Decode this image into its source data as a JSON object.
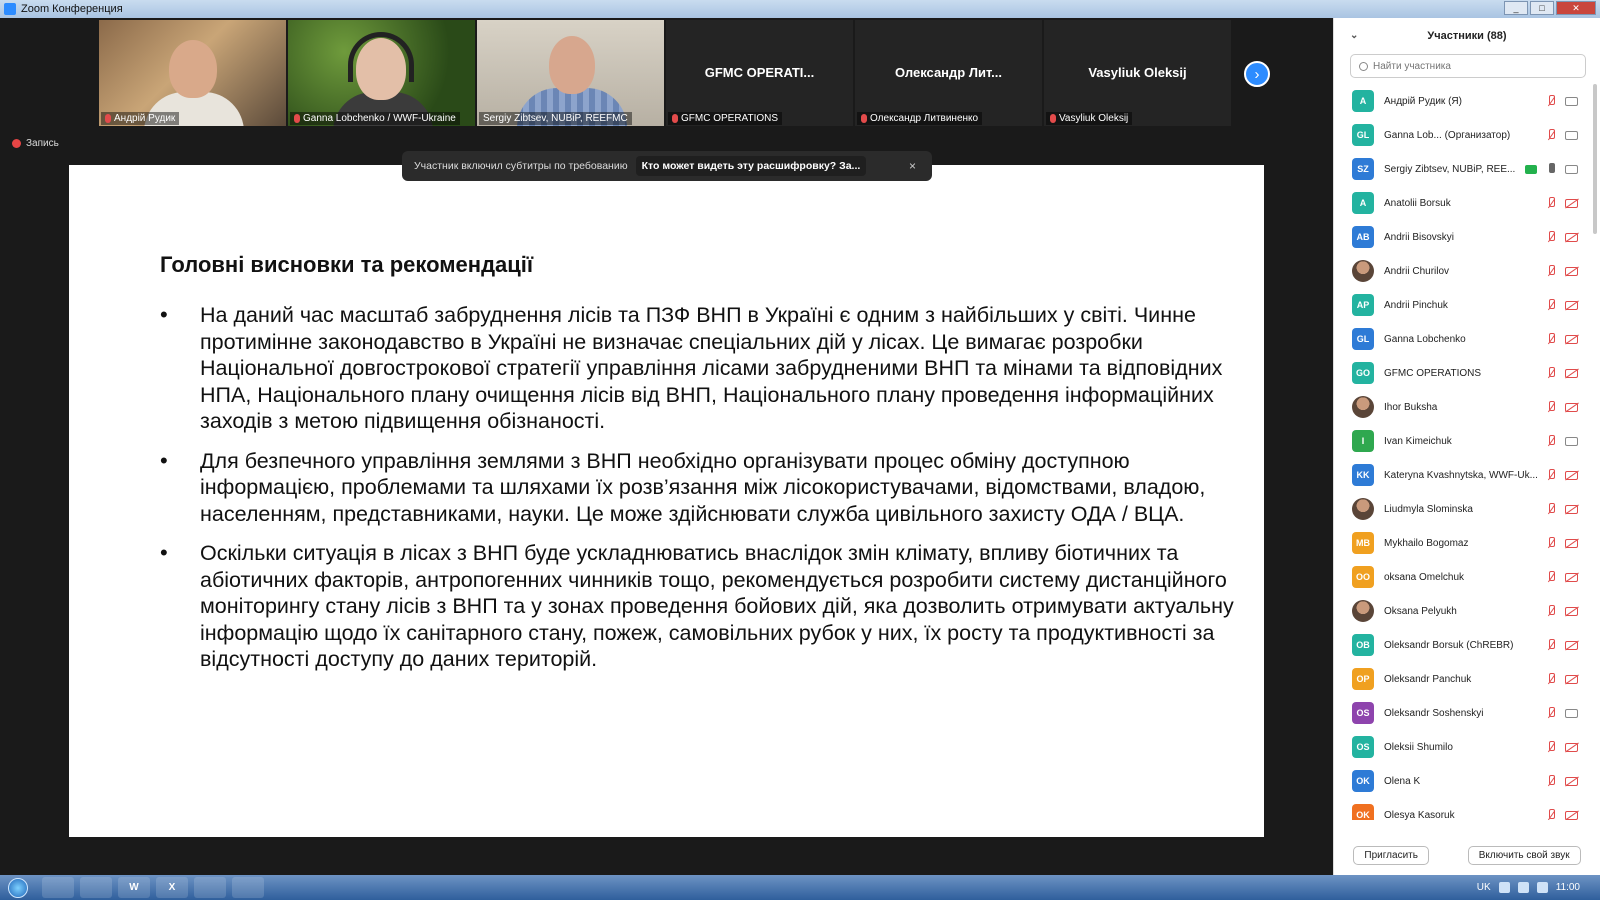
{
  "window": {
    "title": "Zoom Конференция",
    "buttons": [
      "_",
      "□",
      "✕"
    ]
  },
  "gallery": [
    {
      "name": "Андрій Рудик",
      "video": true
    },
    {
      "name": "Ganna Lobchenko / WWF-Ukraine",
      "video": true
    },
    {
      "name": "Sergiy Zibtsev, NUBiP, REEFMC",
      "video": true
    },
    {
      "name": "GFMC OPERATIONS",
      "big": "GFMC  OPERATI...",
      "video": false
    },
    {
      "name": "Олександр Литвиненко",
      "big": "Олександр  Лит...",
      "video": false
    },
    {
      "name": "Vasyliuk  Oleksij",
      "big": "Vasyliuk  Oleksij",
      "video": false
    }
  ],
  "recording_label": "Запись",
  "caption_bar": {
    "message": "Участник включил субтитры по требованию",
    "who": "Кто может видеть эту расшифровку? За...",
    "close": "×"
  },
  "slide": {
    "title": "Головні висновки та рекомендації",
    "bullets": [
      "На даний час масштаб забруднення лісів та ПЗФ ВНП в Україні є одним з найбільших у світі. Чинне протимінне законодавство в Україні не визначає спеціальних дій у лісах. Це вимагає розробки Національної довгострокової стратегії управління лісами забрудненими ВНП та мінами та відповідних НПА, Національного плану очищення лісів від ВНП, Національного плану проведення інформаційних заходів з метою підвищення обізнаності.",
      "Для безпечного управління землями з ВНП необхідно організувати процес обміну доступною інформацією, проблемами та шляхами їх розв’язання між лісокористувачами, відомствами, владою, населенням, представниками, науки. Це може здійснювати служба цивільного захисту ОДА / ВЦА.",
      "Оскільки ситуація в лісах з ВНП буде ускладнюватись внаслідок змін клімату, впливу біотичних та абіотичних факторів, антропогенних чинників тощо, рекомендується розробити систему дистанційного моніторингу стану лісів з ВНП та у зонах проведення бойових дій, яка дозволить отримувати актуальну інформацію щодо їх санітарного стану, пожеж, самовільних рубок у них, їх росту та  продуктивності за відсутності доступу до даних територій."
    ]
  },
  "participants_panel": {
    "title": "Участники (88)",
    "search_placeholder": "Найти участника",
    "invite_label": "Пригласить",
    "unmute_label": "Включить свой звук",
    "list": [
      {
        "initials": "A",
        "name": "Андрій Рудик (Я)",
        "color": "#23b3a0",
        "mic": "off",
        "cam": "on"
      },
      {
        "initials": "GL",
        "name": "Ganna Lob...  (Организатор)",
        "color": "#23b3a0",
        "mic": "off",
        "cam": "on"
      },
      {
        "initials": "SZ",
        "name": "Sergiy Zibtsev, NUBiP, REE...",
        "color": "#2e7bd6",
        "mic": "on",
        "cam": "on",
        "sharing": true
      },
      {
        "initials": "A",
        "name": "Anatolii Borsuk",
        "color": "#23b3a0",
        "mic": "off",
        "cam": "off"
      },
      {
        "initials": "AB",
        "name": "Andrii Bisovskyi",
        "color": "#2e7bd6",
        "mic": "off",
        "cam": "off"
      },
      {
        "initials": "",
        "name": "Andrii Churilov",
        "color": "",
        "photo": true,
        "mic": "off",
        "cam": "off"
      },
      {
        "initials": "AP",
        "name": "Andrii Pinchuk",
        "color": "#23b3a0",
        "mic": "off",
        "cam": "off"
      },
      {
        "initials": "GL",
        "name": "Ganna Lobchenko",
        "color": "#2e7bd6",
        "mic": "off",
        "cam": "off"
      },
      {
        "initials": "GO",
        "name": "GFMC OPERATIONS",
        "color": "#23b3a0",
        "mic": "off",
        "cam": "off"
      },
      {
        "initials": "",
        "name": "Ihor Buksha",
        "color": "",
        "photo": true,
        "mic": "off",
        "cam": "off"
      },
      {
        "initials": "I",
        "name": "Ivan Kimeichuk",
        "color": "#2fa84f",
        "mic": "off",
        "cam": "on"
      },
      {
        "initials": "KK",
        "name": "Kateryna Kvashnytska, WWF-Uk...",
        "color": "#2e7bd6",
        "mic": "off",
        "cam": "off"
      },
      {
        "initials": "",
        "name": "Liudmyla Slominska",
        "color": "",
        "photo": true,
        "mic": "off",
        "cam": "off"
      },
      {
        "initials": "MB",
        "name": "Mykhailo Bogomaz",
        "color": "#f0a020",
        "mic": "off",
        "cam": "off"
      },
      {
        "initials": "OO",
        "name": "oksana Omelchuk",
        "color": "#f0a020",
        "mic": "off",
        "cam": "off"
      },
      {
        "initials": "",
        "name": "Oksana Pelyukh",
        "color": "",
        "photo": true,
        "mic": "off",
        "cam": "off"
      },
      {
        "initials": "OB",
        "name": "Oleksandr Borsuk (ChREBR)",
        "color": "#23b3a0",
        "mic": "off",
        "cam": "off"
      },
      {
        "initials": "OP",
        "name": "Oleksandr Panchuk",
        "color": "#f0a020",
        "mic": "off",
        "cam": "off"
      },
      {
        "initials": "OS",
        "name": "Oleksandr Soshenskyi",
        "color": "#8e44ad",
        "mic": "off",
        "cam": "on"
      },
      {
        "initials": "OS",
        "name": "Oleksii Shumilo",
        "color": "#23b3a0",
        "mic": "off",
        "cam": "off"
      },
      {
        "initials": "OK",
        "name": "Olena K",
        "color": "#2e7bd6",
        "mic": "off",
        "cam": "off"
      },
      {
        "initials": "OK",
        "name": "Olesya Kasoruk",
        "color": "#f07020",
        "mic": "off",
        "cam": "off"
      }
    ]
  },
  "taskbar": {
    "apps": [
      "",
      "",
      "W",
      "X",
      "",
      ""
    ],
    "lang": "UK",
    "time": "11:00"
  }
}
